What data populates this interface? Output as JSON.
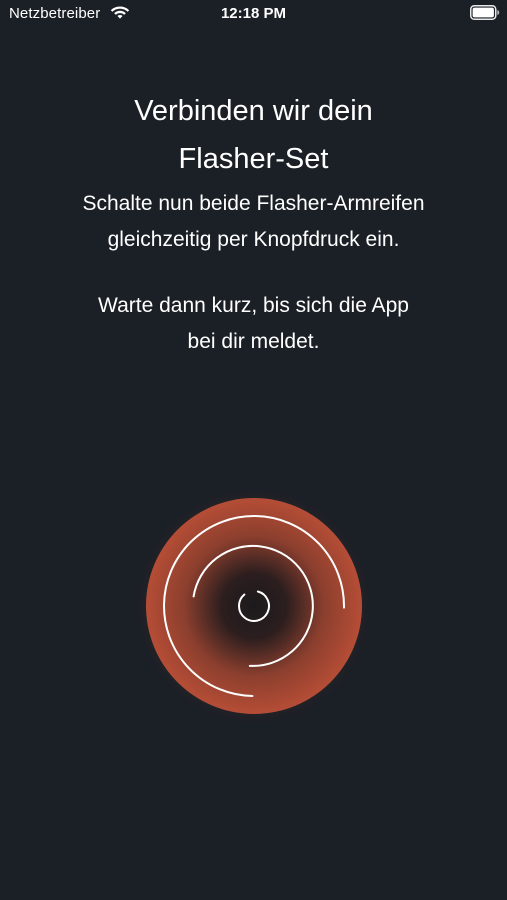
{
  "status_bar": {
    "carrier": "Netzbetreiber",
    "time": "12:18 PM",
    "wifi_icon": "wifi-icon",
    "battery_icon": "battery-icon"
  },
  "onboarding": {
    "title_line1": "Verbinden wir dein",
    "title_line2": "Flasher-Set",
    "instruction1_line1": "Schalte nun beide Flasher-Armreifen",
    "instruction1_line2": "gleichzeitig per Knopfdruck ein.",
    "instruction2_line1": "Warte dann kurz, bis sich die App",
    "instruction2_line2": "bei dir meldet."
  },
  "indicator": {
    "icon": "connecting-spinner-icon",
    "glow_color": "#c4533a",
    "background_color": "#1b2026"
  }
}
